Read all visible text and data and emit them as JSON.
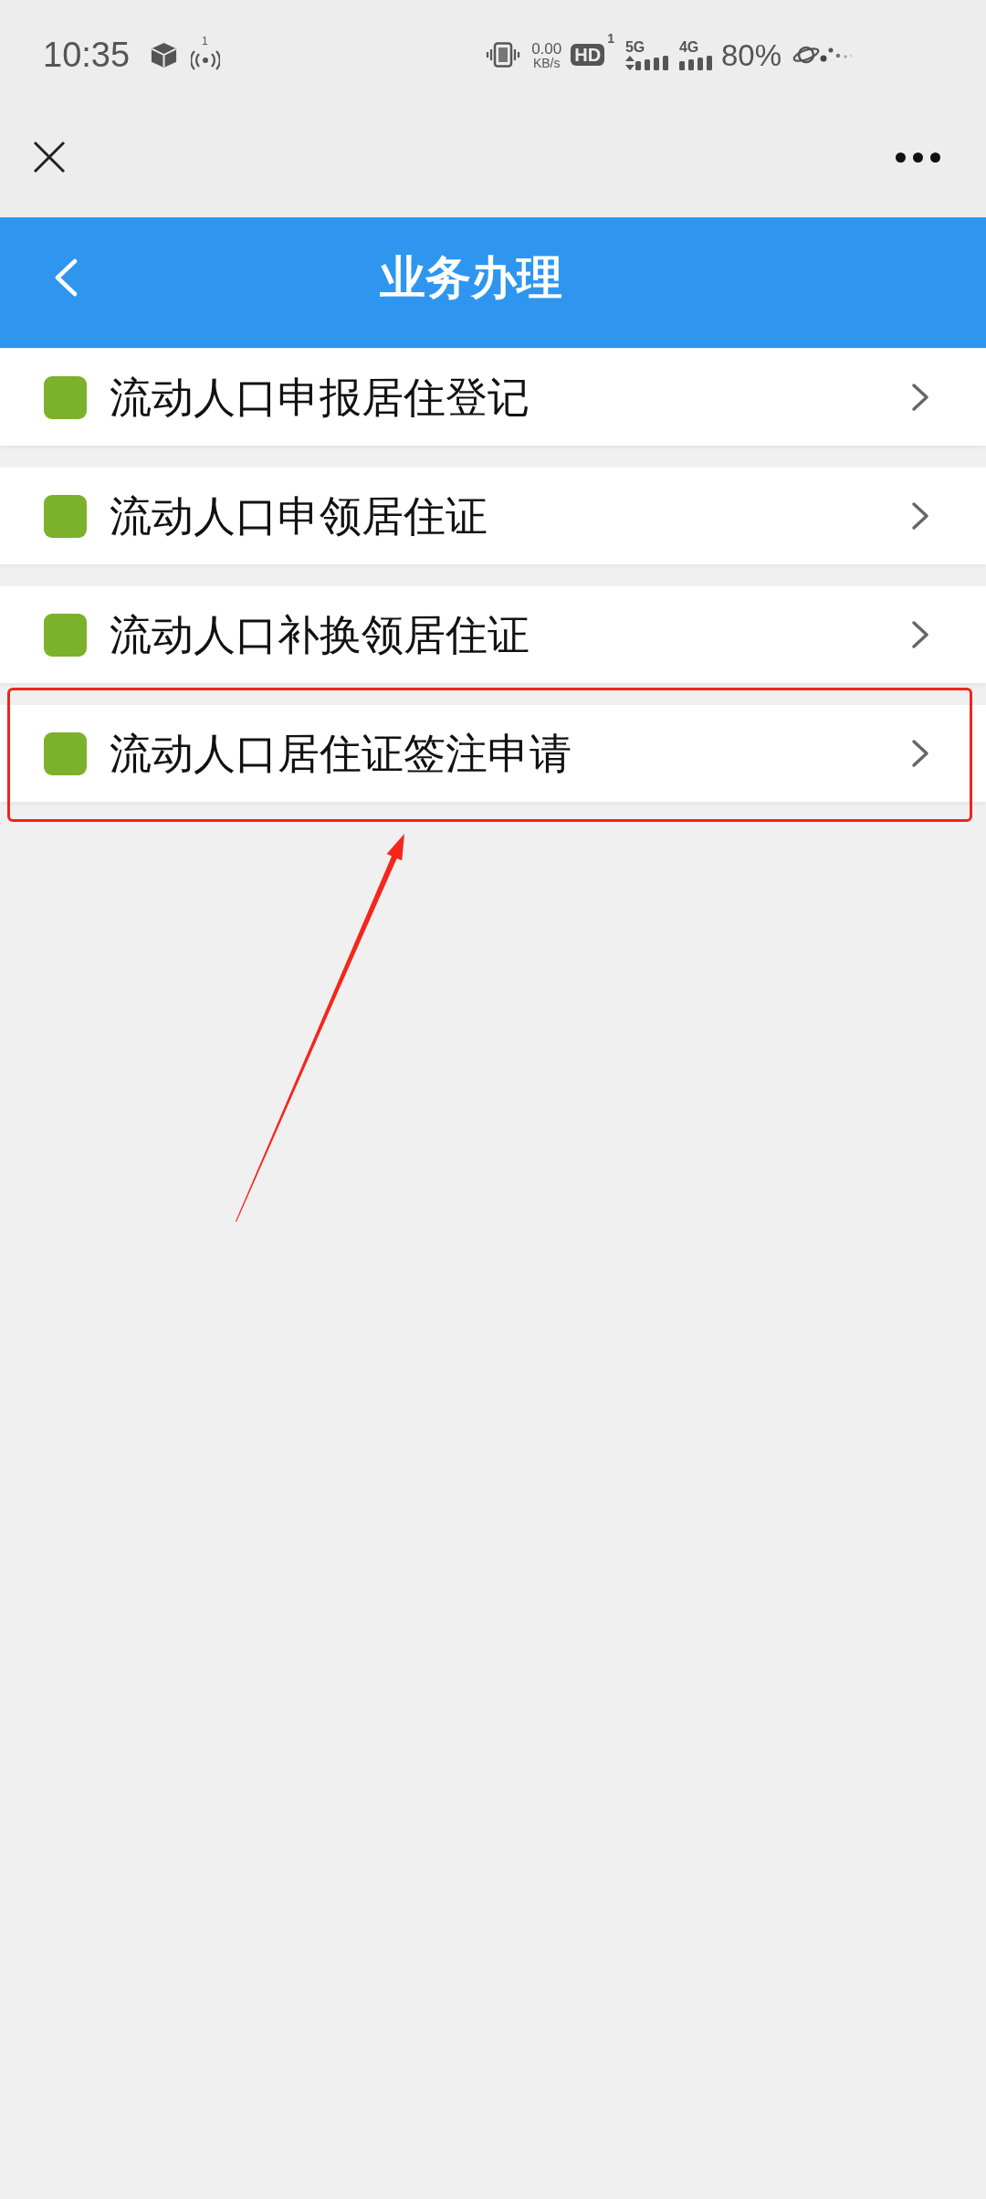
{
  "status_bar": {
    "time": "10:35",
    "hotspot_count": "1",
    "speed_value": "0.00",
    "speed_unit": "KB/s",
    "hd_label": "HD",
    "hd_sim": "1",
    "signals": [
      {
        "label": "5G",
        "activity": true
      },
      {
        "label": "4G",
        "activity": false
      }
    ],
    "battery": "80%"
  },
  "header": {
    "title": "业务办理"
  },
  "items": [
    {
      "label": "流动人口申报居住登记",
      "annotated": false
    },
    {
      "label": "流动人口申领居住证",
      "annotated": false
    },
    {
      "label": "流动人口补换领居住证",
      "annotated": false
    },
    {
      "label": "流动人口居住证签注申请",
      "annotated": true
    }
  ]
}
